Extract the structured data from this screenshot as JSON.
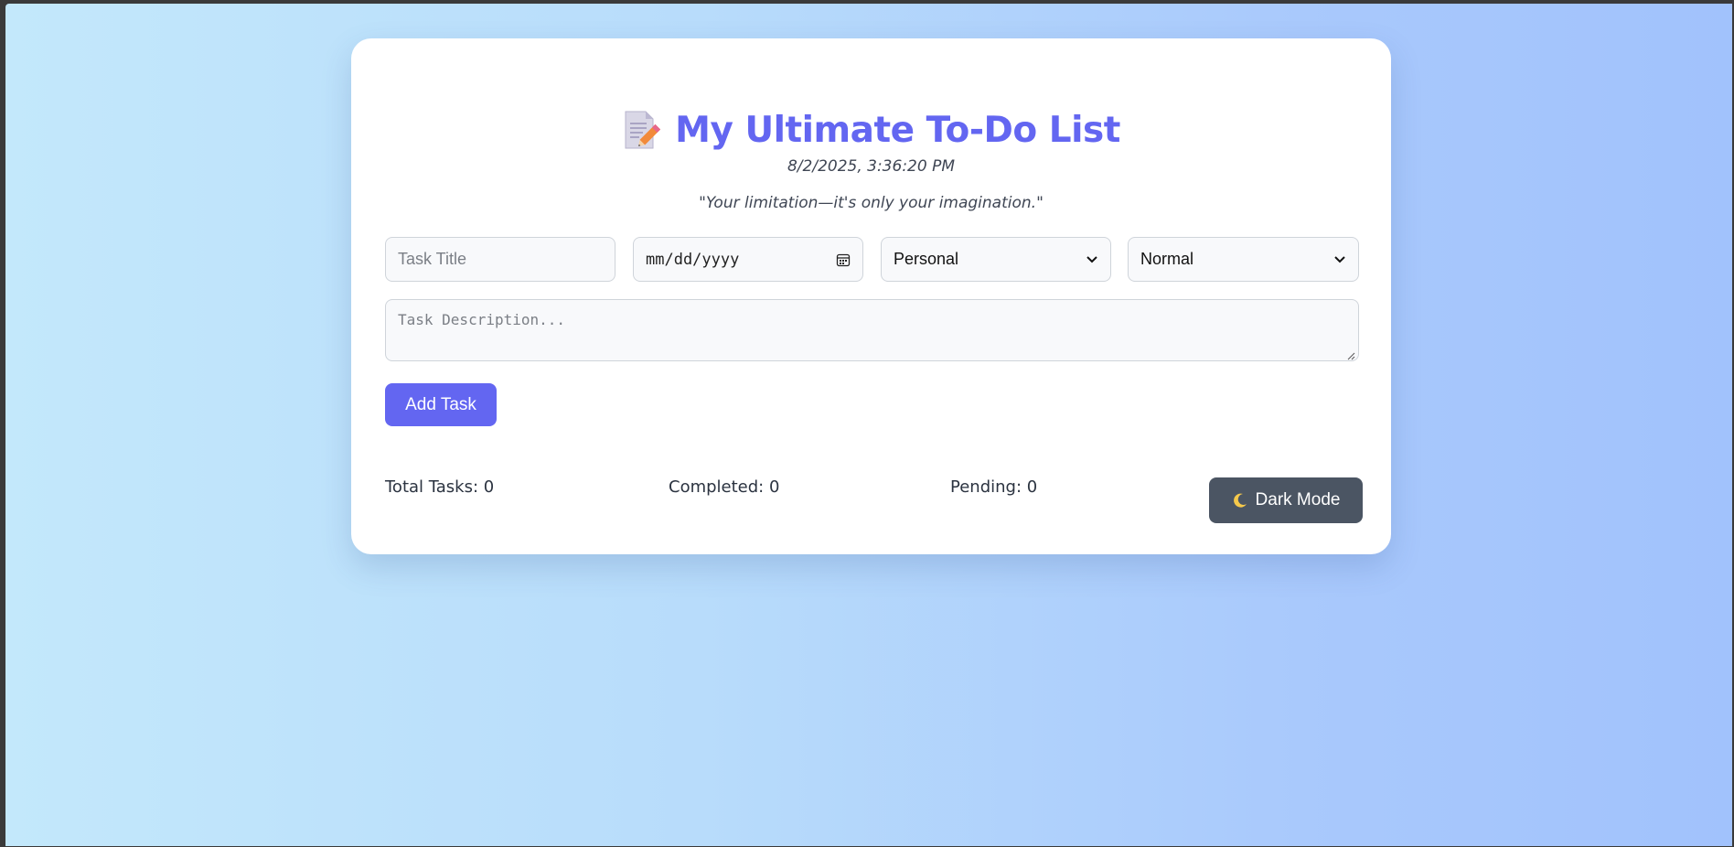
{
  "header": {
    "title": "My Ultimate To-Do List",
    "title_icon": "memo-pencil-icon",
    "datetime": "8/2/2025, 3:36:20 PM",
    "quote": "\"Your limitation—it's only your imagination.\""
  },
  "form": {
    "task_title_placeholder": "Task Title",
    "date_placeholder": "mm/dd/yyyy",
    "category_selected": "Personal",
    "priority_selected": "Normal",
    "description_placeholder": "Task Description...",
    "add_button_label": "Add Task"
  },
  "stats": {
    "total": "Total Tasks: 0",
    "completed": "Completed: 0",
    "pending": "Pending: 0"
  },
  "dark_mode": {
    "label": "Dark Mode",
    "icon": "moon-icon"
  },
  "colors": {
    "accent": "#6366f1",
    "dark_button": "#4b5563",
    "background_start": "#c3e8fb",
    "background_end": "#a1c2fc"
  }
}
